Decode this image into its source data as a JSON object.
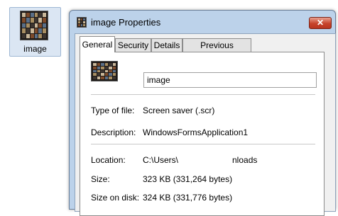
{
  "desktop": {
    "icon_label": "image"
  },
  "window": {
    "title": "image Properties",
    "close_glyph": "✕",
    "tabs": [
      {
        "label": "General",
        "active": true
      },
      {
        "label": "Security"
      },
      {
        "label": "Details"
      },
      {
        "label": "Previous Versions"
      }
    ]
  },
  "general": {
    "file_name": "image",
    "type_label": "Type of file:",
    "type_value": "Screen saver (.scr)",
    "description_label": "Description:",
    "description_value": "WindowsFormsApplication1",
    "location_label": "Location:",
    "location_value_start": "C:\\Users\\",
    "location_value_end": "nloads",
    "size_label": "Size:",
    "size_value": "323 KB (331,264 bytes)",
    "size_on_disk_label": "Size on disk:",
    "size_on_disk_value": "324 KB (331,776 bytes)"
  },
  "icons": {
    "desktop_icon": "image-thumbnail-icon",
    "title_icon": "image-thumbnail-icon",
    "file_icon": "image-thumbnail-icon",
    "close": "close-icon"
  },
  "colors": {
    "titlebar": "#bcd2ea",
    "close_button": "#c7432b",
    "selection": "#dbe6f3"
  }
}
